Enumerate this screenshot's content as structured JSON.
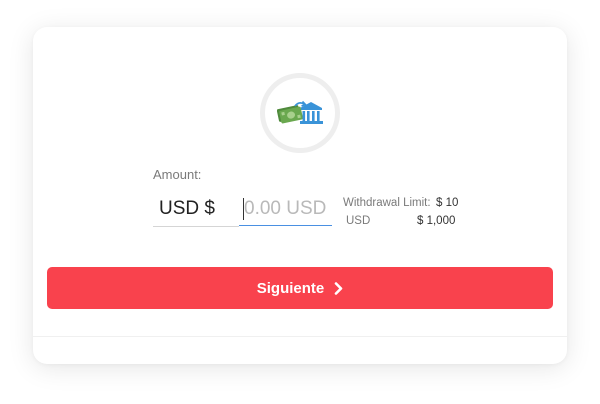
{
  "withdraw": {
    "icon": "cash-to-bank-icon",
    "amount_label": "Amount:",
    "currency": "USD $",
    "amount_placeholder": "0.00 USD",
    "amount_value": "",
    "limit_label": "Withdrawal Limit:",
    "limit_min": "$ 10",
    "limit_unit": "USD",
    "limit_max": "$ 1,000",
    "next_button_label": "Siguiente",
    "next_button_icon": "chevron-right-icon"
  },
  "colors": {
    "accent": "#f9424d",
    "cash": "#6aa84f",
    "bank": "#3a93d8",
    "input_focus": "#4a90e2"
  }
}
